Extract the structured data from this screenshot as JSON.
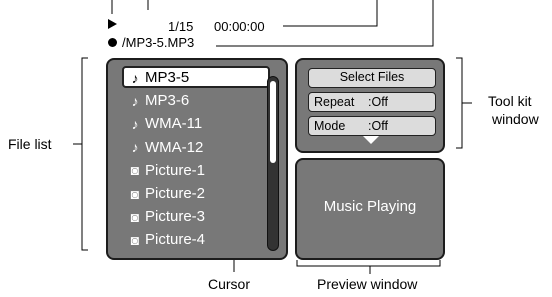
{
  "status_bar": {
    "play_icon": "play-icon",
    "track_counter": "1/15",
    "time": "00:00:00",
    "disc_icon": "disc-icon",
    "file_path": "/MP3-5.MP3"
  },
  "file_list": {
    "items": [
      {
        "icon": "music-note-icon",
        "glyph": "♪",
        "label": "MP3-5",
        "selected": true
      },
      {
        "icon": "music-note-icon",
        "glyph": "♪",
        "label": "MP3-6"
      },
      {
        "icon": "music-note-icon",
        "glyph": "♪",
        "label": "WMA-11"
      },
      {
        "icon": "music-note-icon",
        "glyph": "♪",
        "label": "WMA-12"
      },
      {
        "icon": "picture-icon",
        "glyph": "◙",
        "label": "Picture-1"
      },
      {
        "icon": "picture-icon",
        "glyph": "◙",
        "label": "Picture-2"
      },
      {
        "icon": "picture-icon",
        "glyph": "◙",
        "label": "Picture-3"
      },
      {
        "icon": "picture-icon",
        "glyph": "◙",
        "label": "Picture-4"
      }
    ]
  },
  "tool_kit": {
    "select_files": "Select Files",
    "repeat_label": "Repeat",
    "repeat_value": ":Off",
    "mode_label": "Mode",
    "mode_value": ":Off",
    "more_icon": "triangle-down-icon"
  },
  "preview": {
    "text": "Music Playing"
  },
  "callouts": {
    "file_list": "File list",
    "tool_kit_line1": "Tool kit",
    "tool_kit_line2": "window",
    "cursor": "Cursor",
    "preview_window": "Preview window"
  },
  "colors": {
    "panel_gray": "#787878",
    "button_gray": "#dcdcdc",
    "border_dark": "#1c1c1c"
  }
}
